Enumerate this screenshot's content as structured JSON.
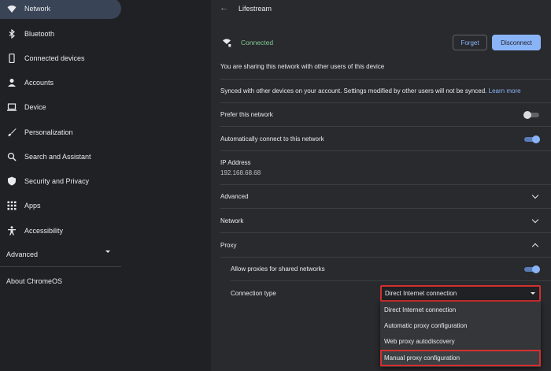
{
  "sidebar": {
    "items": [
      {
        "label": "Network",
        "icon": "wifi-icon"
      },
      {
        "label": "Bluetooth",
        "icon": "bluetooth-icon"
      },
      {
        "label": "Connected devices",
        "icon": "phone-icon"
      },
      {
        "label": "Accounts",
        "icon": "person-icon"
      },
      {
        "label": "Device",
        "icon": "laptop-icon"
      },
      {
        "label": "Personalization",
        "icon": "brush-icon"
      },
      {
        "label": "Search and Assistant",
        "icon": "search-icon"
      },
      {
        "label": "Security and Privacy",
        "icon": "shield-icon"
      },
      {
        "label": "Apps",
        "icon": "apps-grid-icon"
      },
      {
        "label": "Accessibility",
        "icon": "accessibility-icon"
      }
    ],
    "advanced_label": "Advanced",
    "about_label": "About ChromeOS"
  },
  "header": {
    "title": "Lifestream"
  },
  "status": {
    "connected_label": "Connected",
    "forget_label": "Forget",
    "disconnect_label": "Disconnect"
  },
  "sharing_text": "You are sharing this network with other users of this device",
  "sync_text": "Synced with other devices on your account. Settings modified by other users will not be synced.",
  "learn_more_label": "Learn more",
  "prefer_label": "Prefer this network",
  "prefer_on": false,
  "auto_connect_label": "Automatically connect to this network",
  "auto_connect_on": true,
  "ip": {
    "label": "IP Address",
    "value": "192.168.68.68"
  },
  "sections": {
    "advanced": "Advanced",
    "network": "Network",
    "proxy": "Proxy"
  },
  "proxy": {
    "allow_shared_label": "Allow proxies for shared networks",
    "allow_shared_on": true,
    "connection_type_label": "Connection type",
    "selected": "Direct Internet connection",
    "options": [
      "Direct Internet connection",
      "Automatic proxy configuration",
      "Web proxy autodiscovery",
      "Manual proxy configuration"
    ]
  },
  "colors": {
    "accent": "#8ab4f8",
    "connected": "#81c995",
    "highlight_border": "#d32f2f"
  }
}
